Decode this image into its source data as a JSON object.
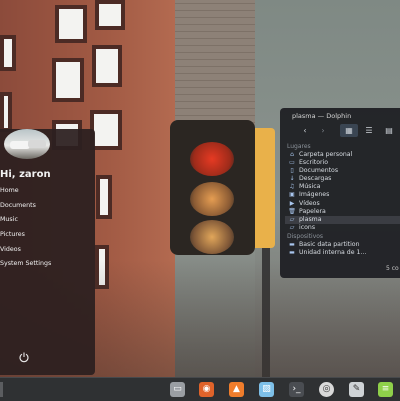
{
  "launcher": {
    "greeting": "Hi, zaron",
    "items": [
      {
        "label": "Home"
      },
      {
        "label": "Documents"
      },
      {
        "label": "Music"
      },
      {
        "label": "Pictures"
      },
      {
        "label": "Videos"
      },
      {
        "label": "System Settings"
      }
    ],
    "power_icon": "power-icon"
  },
  "dolphin": {
    "title": "plasma — Dolphin",
    "sections": {
      "places": "Lugares",
      "devices": "Dispositivos"
    },
    "places": [
      {
        "label": "Carpeta personal",
        "icon": "home-icon"
      },
      {
        "label": "Escritorio",
        "icon": "desktop-icon"
      },
      {
        "label": "Documentos",
        "icon": "documents-icon"
      },
      {
        "label": "Descargas",
        "icon": "downloads-icon"
      },
      {
        "label": "Música",
        "icon": "music-icon"
      },
      {
        "label": "Imágenes",
        "icon": "pictures-icon"
      },
      {
        "label": "Vídeos",
        "icon": "videos-icon"
      },
      {
        "label": "Papelera",
        "icon": "trash-icon"
      },
      {
        "label": "plasma",
        "icon": "folder-icon",
        "selected": true
      },
      {
        "label": "icons",
        "icon": "folder-icon"
      }
    ],
    "devices": [
      {
        "label": "Basic data partition",
        "icon": "drive-icon"
      },
      {
        "label": "Unidad interna de 1...",
        "icon": "drive-icon"
      }
    ],
    "status": "5 co"
  },
  "taskbar": {
    "icons": [
      "files-icon",
      "firefox-icon",
      "store-icon",
      "image-viewer-icon",
      "terminal-icon",
      "settings-icon",
      "editor-icon",
      "android-icon"
    ]
  },
  "colors": {
    "accent": "#a9c6ee",
    "selection": "#3b3d43"
  }
}
